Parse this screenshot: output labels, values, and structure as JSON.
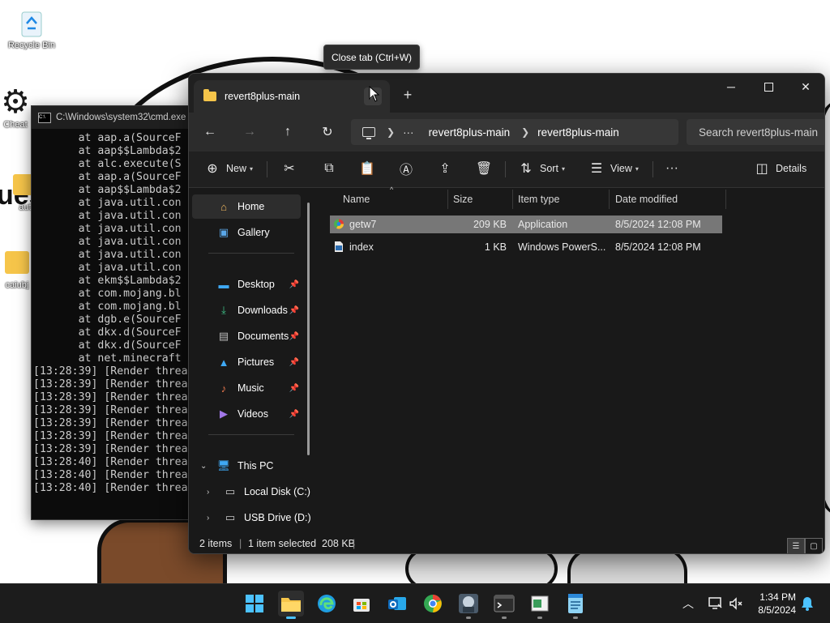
{
  "desktop": {
    "icons": [
      {
        "label": "Recycle Bin"
      },
      {
        "label": "Cheat"
      },
      {
        "label": "aut"
      },
      {
        "label": "caiubj"
      }
    ],
    "wall_text": "ues"
  },
  "cmd": {
    "title": "C:\\Windows\\system32\\cmd.exe",
    "lines": [
      "       at aap.a(SourceF",
      "       at aap$$Lambda$2",
      "       at alc.execute(S",
      "       at aap.a(SourceF",
      "       at aap$$Lambda$2",
      "       at java.util.con",
      "       at java.util.con",
      "       at java.util.con",
      "       at java.util.con",
      "       at java.util.con",
      "       at java.util.con",
      "       at ekm$$Lambda$2",
      "       at com.mojang.bl",
      "       at com.mojang.bl",
      "       at dgb.e(SourceF",
      "       at dkx.d(SourceF",
      "       at dkx.d(SourceF",
      "       at net.minecraft",
      "[13:28:39] [Render threa",
      "[13:28:39] [Render threa",
      "[13:28:39] [Render threa",
      "[13:28:39] [Render threa",
      "[13:28:39] [Render threa",
      "[13:28:39] [Render threa",
      "[13:28:39] [Render threa",
      "[13:28:40] [Render threa",
      "[13:28:40] [Render threa",
      "[13:28:40] [Render threa"
    ]
  },
  "tooltip": {
    "text": "Close tab (Ctrl+W)"
  },
  "explorer": {
    "tab_title": "revert8plus-main",
    "window_controls": {
      "minimize": "─",
      "maximize": "",
      "close": "✕"
    },
    "address": {
      "overflow": "···",
      "crumbs": [
        "revert8plus-main",
        "revert8plus-main"
      ]
    },
    "search_placeholder": "Search revert8plus-main",
    "toolbar": {
      "new_label": "New",
      "sort_label": "Sort",
      "view_label": "View",
      "more_label": "···",
      "details_label": "Details"
    },
    "nav": {
      "home": "Home",
      "gallery": "Gallery",
      "desktop": "Desktop",
      "downloads": "Downloads",
      "documents": "Documents",
      "pictures": "Pictures",
      "music": "Music",
      "videos": "Videos",
      "this_pc": "This PC",
      "local_disk": "Local Disk (C:)",
      "usb_drive": "USB Drive (D:)"
    },
    "columns": {
      "name": "Name",
      "size": "Size",
      "type": "Item type",
      "modified": "Date modified"
    },
    "files": [
      {
        "name": "getw7",
        "size": "209 KB",
        "type": "Application",
        "modified": "8/5/2024 12:08 PM"
      },
      {
        "name": "index",
        "size": "1 KB",
        "type": "Windows PowerS...",
        "modified": "8/5/2024 12:08 PM"
      }
    ],
    "status": {
      "count": "2 items",
      "selected": "1 item selected  208 KB"
    }
  },
  "taskbar": {
    "clock_time": "1:34 PM",
    "clock_date": "8/5/2024"
  },
  "colors": {
    "accent": "#4cc2ff",
    "folder": "#f6c54a",
    "selected_row": "#777777",
    "window_bg": "#191919"
  }
}
